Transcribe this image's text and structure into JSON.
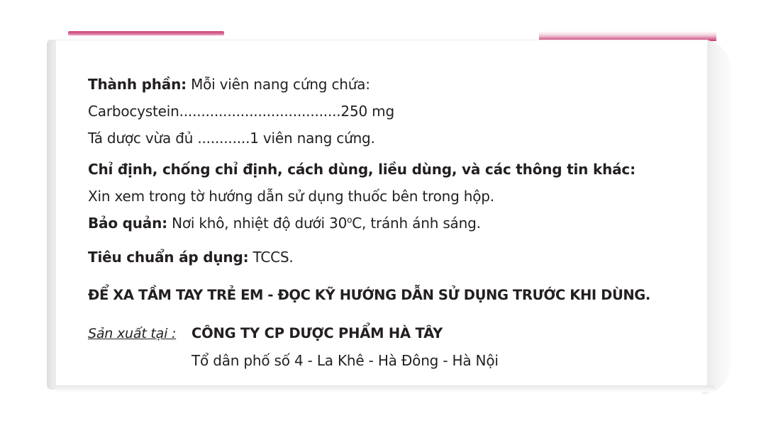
{
  "composition": {
    "label": "Thành phần:",
    "intro": " Mỗi viên nang cứng chứa:",
    "line1": "Carbocystein.....................................250 mg",
    "line2": "Tá dược vừa đủ ............1 viên nang cứng."
  },
  "indications": {
    "heading": "Chỉ định, chống chỉ định, cách dùng, liều dùng, và các thông tin khác:",
    "text": "Xin xem trong tờ hướng dẫn sử dụng thuốc bên trong hộp."
  },
  "storage": {
    "label": "Bảo quản:",
    "text_before": " Nơi khô, nhiệt độ dưới 30",
    "superscript": "o",
    "text_after": "C, tránh ánh sáng."
  },
  "standard": {
    "label": "Tiêu chuẩn áp dụng:",
    "value": " TCCS."
  },
  "warning": "ĐỂ XA TẦM TAY TRẺ EM - ĐỌC KỸ HƯỚNG DẪN SỬ DỤNG TRƯỚC KHI DÙNG.",
  "manufacturer": {
    "label": "Sản xuất tại :",
    "name": "CÔNG TY CP DƯỢC PHẨM HÀ TÂY",
    "address": "Tổ dân phố số 4 - La Khê - Hà Đông - Hà Nội"
  },
  "colors": {
    "accent_pink": "#c7386f",
    "text": "#231f20"
  }
}
